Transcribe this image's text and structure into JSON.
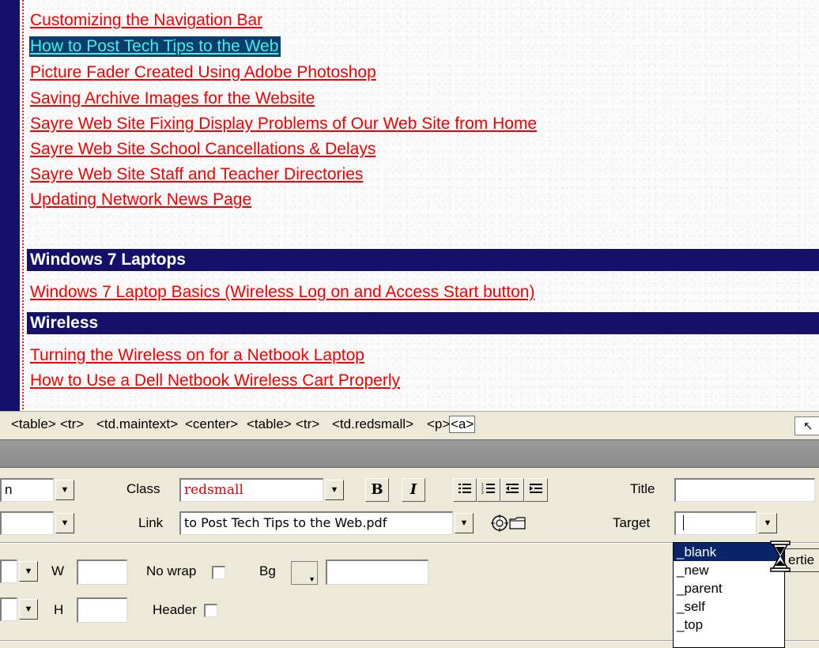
{
  "document": {
    "links_top": [
      "Customizing the Navigation Bar",
      "How to Post Tech Tips to the Web",
      "Picture Fader Created Using Adobe Photoshop",
      "Saving Archive Images for the Website",
      "Sayre Web Site Fixing Display Problems of Our Web Site from Home",
      "Sayre Web Site School Cancellations & Delays",
      "Sayre Web Site Staff and Teacher Directories",
      "Updating Network News Page"
    ],
    "section_windows7": {
      "heading": "Windows 7 Laptops",
      "links": [
        "Windows 7 Laptop Basics (Wireless Log on and Access Start button)"
      ]
    },
    "section_wireless": {
      "heading": "Wireless",
      "links": [
        "Turning the Wireless on for a Netbook Laptop",
        "How to Use a Dell Netbook Wireless Cart Properly"
      ]
    },
    "colors": {
      "link": "#f40000",
      "section_bg": "#15116b",
      "selected_bg": "#0b3c6b",
      "selected_text": "#40f0e8"
    }
  },
  "tag_selector": {
    "tags": [
      "<table>",
      "<tr>",
      "<td.maintext>",
      "<center>",
      "<table>",
      "<tr>",
      "<td.redsmall>",
      "<p>",
      "<a>"
    ],
    "active": "<a>"
  },
  "inspector": {
    "format_value": "n",
    "class_label": "Class",
    "class_value": "redsmall",
    "bold_label": "B",
    "italic_label": "I",
    "title_label": "Title",
    "title_value": "",
    "link_label": "Link",
    "link_value": "to Post Tech Tips to the Web.pdf",
    "target_label": "Target",
    "target_value": "",
    "target_options": [
      "_blank",
      "_new",
      "_parent",
      "_self",
      "_top"
    ],
    "target_highlighted": "_blank",
    "w_label": "W",
    "h_label": "H",
    "nowrap_label": "No wrap",
    "header_label": "Header",
    "bg_label": "Bg",
    "properties_button_partial": "ertie"
  }
}
